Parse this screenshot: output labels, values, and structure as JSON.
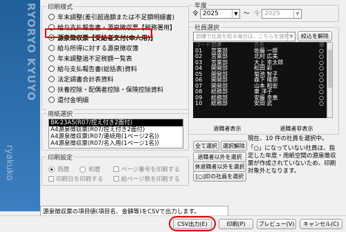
{
  "sidebar": {
    "vertical_text": "RYORYO KYUYO",
    "bottom_text": "ryakuko"
  },
  "print_format": {
    "label": "印刷様式",
    "options": [
      {
        "label": "年末調整(差引超過額または不足額明細書)",
        "selected": false
      },
      {
        "label": "給与支払報告書・源泉徴収票【税務署用】",
        "selected": false
      },
      {
        "label": "源泉徴収票【受給者交付(本人用)】",
        "selected": true
      },
      {
        "label": "給与所得に対する源泉徴収簿",
        "selected": false
      },
      {
        "label": "年末調整過不足税額一覧表",
        "selected": false
      },
      {
        "label": "給与支払報告書(総括表)資料",
        "selected": false
      },
      {
        "label": "法定調書合計表資料",
        "selected": false
      },
      {
        "label": "扶養控除・配偶者控除・保険控除資料",
        "selected": false
      },
      {
        "label": "還付金明細",
        "selected": false
      }
    ]
  },
  "paper_select": {
    "label": "用紙選択",
    "items": [
      "BK-23A5(R07/控え付き2面付)",
      "A4源泉徴収票(R07/控え付き2面付)",
      "A4源泉徴収票(R07/連続用(1ページ2名))",
      "A4源泉徴収票(R07/名入用(1ページ1名))"
    ],
    "selected_index": 0
  },
  "print_settings": {
    "label": "印刷設定",
    "seireki": "西暦",
    "wareki": "和暦",
    "page_number": "ページ番号を印刷する",
    "print_date": "印刷日を印刷する",
    "total_pages": "総ページ数を印刷する"
  },
  "year": {
    "label": "年度",
    "from_era": "令",
    "from_value": "2025",
    "to_sep": "〜",
    "to_era": "令",
    "to_value": "2025"
  },
  "employee_select": {
    "label": "社員選択",
    "search_placeholder": "部課で社員を絞る場合は、こちらを選択",
    "filter_button": "絞込を解除",
    "header": [
      "コード",
      "部課",
      "氏名",
      "選"
    ],
    "rows": [
      {
        "code": "01",
        "dept": "営業部",
        "name": "佐藤 一郎",
        "mark": "○"
      },
      {
        "code": "02",
        "dept": "営業部",
        "name": "北村 広美",
        "mark": "○"
      },
      {
        "code": "03",
        "dept": "営業部",
        "name": "大上 幸太郎",
        "mark": "○"
      },
      {
        "code": "04",
        "dept": "開発部",
        "name": "松田 彩",
        "mark": "○"
      },
      {
        "code": "05",
        "dept": "開発部",
        "name": "菊池 智子",
        "mark": "○"
      },
      {
        "code": "06",
        "dept": "開発部",
        "name": "森下 隆宗",
        "mark": "○"
      },
      {
        "code": "07",
        "dept": "開発部",
        "name": "山本 和宏",
        "mark": "○"
      },
      {
        "code": "08",
        "dept": "総務部",
        "name": "東 洋子",
        "mark": "○"
      },
      {
        "code": "09",
        "dept": "総務部",
        "name": "安藤 幸恵",
        "mark": "○"
      },
      {
        "code": "10",
        "dept": "総務部",
        "name": "安田 武",
        "mark": "○"
      }
    ],
    "retired_show": "退職者表示",
    "retired_hide": "退職者非表示"
  },
  "buttons": {
    "select_all": "全て選択",
    "deselect": "選択解除",
    "select_retired_only": "退職者以外を選択",
    "select_leave_only": "休退職者以外を選択",
    "select_circle": "[○]印の社員を選択",
    "csv": "CSV出力(E)",
    "print": "印刷(P)",
    "preview": "プレビュー(V)",
    "cancel": "キャンセル(C)"
  },
  "notes": {
    "count": "現在、10 件の社員を選択中。",
    "info": "「○」になっていない社員は、指定した年度・用紙空間の源泉徴収票が作成されていないため、印刷対象外となります。"
  },
  "status_text": "源泉徴収票の項目値(項目名、金額等)をCSVで出力します。"
}
